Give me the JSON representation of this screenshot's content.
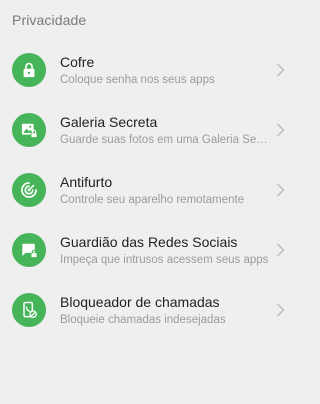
{
  "section": {
    "title": "Privacidade"
  },
  "colors": {
    "accent": "#46b458",
    "background": "#efefef",
    "title_text": "#222222",
    "subtitle_text": "#9b9b9b",
    "section_text": "#7a7a7a",
    "chevron": "#c4c4c4"
  },
  "items": [
    {
      "title": "Cofre",
      "subtitle": "Coloque senha nos seus apps",
      "icon": "lock-icon"
    },
    {
      "title": "Galeria Secreta",
      "subtitle": "Guarde suas fotos em uma Galeria Secreta",
      "icon": "secret-gallery-icon"
    },
    {
      "title": "Antifurto",
      "subtitle": "Controle seu aparelho remotamente",
      "icon": "anti-theft-radar-icon"
    },
    {
      "title": "Guardião das Redes Sociais",
      "subtitle": "Impeça que intrusos acessem seus apps",
      "icon": "social-chat-lock-icon"
    },
    {
      "title": "Bloqueador de chamadas",
      "subtitle": "Bloqueie chamadas indesejadas",
      "icon": "call-blocker-icon"
    }
  ]
}
